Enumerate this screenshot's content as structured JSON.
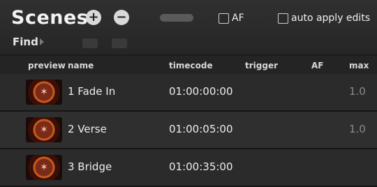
{
  "title": "Scenes",
  "add_icon": "plus-circle-icon",
  "remove_icon": "minus-circle-icon",
  "af_checkbox": {
    "label": "AF",
    "checked": false
  },
  "apply_checkbox": {
    "label": "auto apply edits",
    "checked": false
  },
  "find_label": "Find",
  "columns": {
    "preview": "preview",
    "name": "name",
    "timecode": "timecode",
    "trigger": "trigger",
    "af": "AF",
    "max": "max"
  },
  "scenes": [
    {
      "name": "1 Fade In",
      "timecode": "01:00:00:00",
      "trigger": "",
      "af": "",
      "max": "1.0"
    },
    {
      "name": "2 Verse",
      "timecode": "01:00:05:00",
      "trigger": "",
      "af": "",
      "max": "1.0"
    },
    {
      "name": "3 Bridge",
      "timecode": "01:00:35:00",
      "trigger": "",
      "af": "",
      "max": ""
    }
  ]
}
